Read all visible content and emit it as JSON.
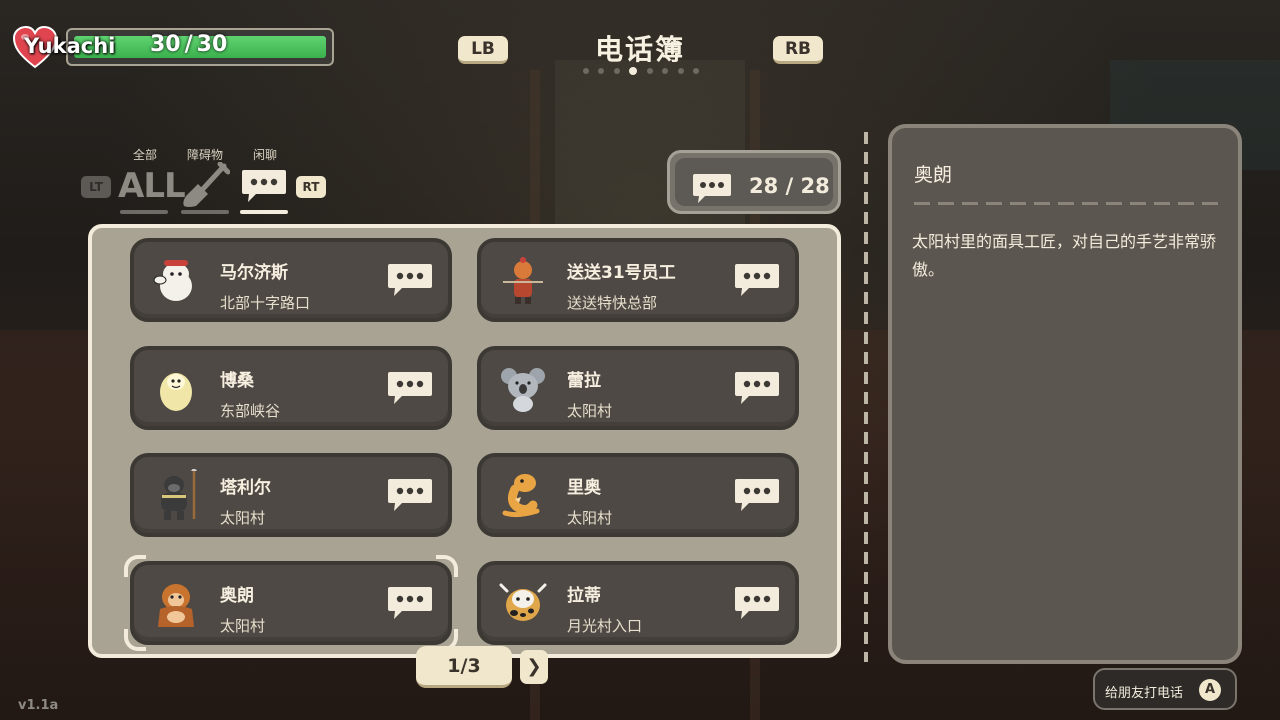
{
  "player": {
    "name": "Yukachi",
    "hp_current": "30",
    "hp_separator": "/",
    "hp_max": "30",
    "hp_fraction": 1.0
  },
  "header": {
    "title": "电话簿",
    "left_bumper": "LB",
    "right_bumper": "RB",
    "page_dots_count": 8,
    "page_dots_active": 4
  },
  "filters": {
    "left_trigger": "LT",
    "right_trigger": "RT",
    "tabs": [
      {
        "label": "全部",
        "icon": "all-text",
        "text": "ALL",
        "active": false
      },
      {
        "label": "障碍物",
        "icon": "shovel-icon",
        "active": false
      },
      {
        "label": "闲聊",
        "icon": "chat-bubble-icon",
        "active": true
      }
    ]
  },
  "counter": {
    "text": "28 / 28",
    "icon": "chat-bubble-icon"
  },
  "contacts": [
    {
      "name": "马尔济斯",
      "location": "北部十字路口",
      "avatar": "white-dog-avatar",
      "selected": false
    },
    {
      "name": "送送31号员工",
      "location": "送送特快总部",
      "avatar": "courier-avatar",
      "selected": false
    },
    {
      "name": "博桑",
      "location": "东部峡谷",
      "avatar": "yeti-avatar",
      "selected": false
    },
    {
      "name": "蕾拉",
      "location": "太阳村",
      "avatar": "koala-avatar",
      "selected": false
    },
    {
      "name": "塔利尔",
      "location": "太阳村",
      "avatar": "gorilla-spear-avatar",
      "selected": false
    },
    {
      "name": "里奥",
      "location": "太阳村",
      "avatar": "lizard-avatar",
      "selected": false
    },
    {
      "name": "奥朗",
      "location": "太阳村",
      "avatar": "orangutan-avatar",
      "selected": true
    },
    {
      "name": "拉蒂",
      "location": "月光村入口",
      "avatar": "cow-avatar",
      "selected": false
    }
  ],
  "pager": {
    "text": "1/3",
    "next": "❯"
  },
  "detail": {
    "name": "奥朗",
    "description": "太阳村里的面具工匠，对自己的手艺非常骄傲。"
  },
  "action": {
    "label": "给朋友打电话",
    "key": "A"
  },
  "version": "v1.1a",
  "colors": {
    "hp_green": "#4cc35c",
    "panel_cream": "#f3ecdc",
    "card_dark": "#4e4944",
    "heart_red": "#e0454f"
  }
}
